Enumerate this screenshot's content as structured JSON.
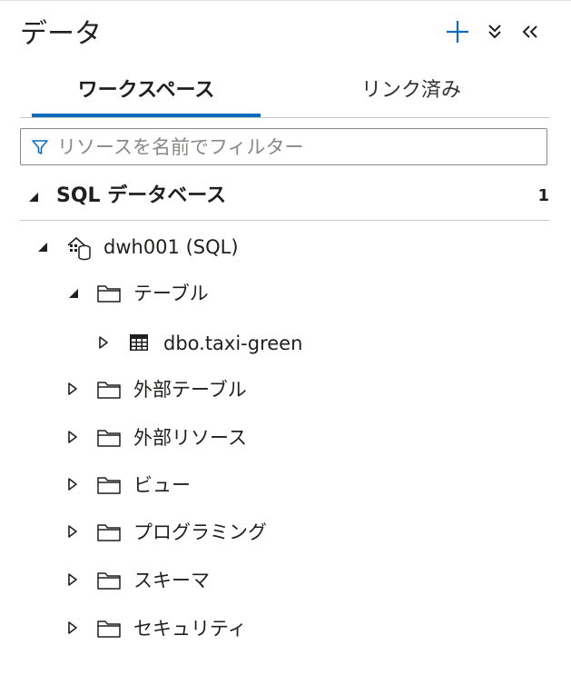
{
  "header": {
    "title": "データ",
    "add_icon": "plus-icon",
    "collapse_all_icon": "double-chevron-down-icon",
    "collapse_panel_icon": "double-chevron-left-icon"
  },
  "tabs": [
    {
      "label": "ワークスペース",
      "active": true
    },
    {
      "label": "リンク済み",
      "active": false
    }
  ],
  "filter": {
    "placeholder": "リソースを名前でフィルター",
    "value": "",
    "icon": "filter-icon"
  },
  "section": {
    "title": "SQL データベース",
    "count": "1",
    "expanded": true
  },
  "tree": {
    "database": {
      "label": "dwh001 (SQL)",
      "icon": "sql-database-icon",
      "expanded": true
    },
    "tables_folder": {
      "label": "テーブル",
      "icon": "folder-icon",
      "expanded": true
    },
    "table": {
      "label": "dbo.taxi-green",
      "icon": "table-icon",
      "expanded": false
    },
    "folders": [
      {
        "label": "外部テーブル",
        "icon": "folder-icon"
      },
      {
        "label": "外部リソース",
        "icon": "folder-icon"
      },
      {
        "label": "ビュー",
        "icon": "folder-icon"
      },
      {
        "label": "プログラミング",
        "icon": "folder-icon"
      },
      {
        "label": "スキーマ",
        "icon": "folder-icon"
      },
      {
        "label": "セキュリティ",
        "icon": "folder-icon"
      }
    ]
  },
  "colors": {
    "accent": "#0f6cbd",
    "text": "#201f1e",
    "placeholder": "#8a8886",
    "divider": "#c8c6c4"
  }
}
